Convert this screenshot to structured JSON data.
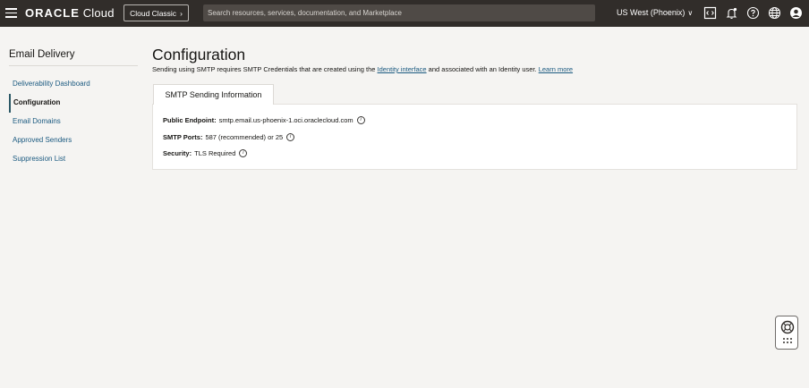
{
  "header": {
    "brand_oracle": "ORACLE",
    "brand_cloud": "Cloud",
    "classic_button": "Cloud Classic",
    "search_placeholder": "Search resources, services, documentation, and Marketplace",
    "region": "US West (Phoenix)",
    "icons": [
      "menu-icon",
      "code-editor-icon",
      "bell-icon",
      "help-icon",
      "globe-icon",
      "profile-icon"
    ]
  },
  "sidebar": {
    "title": "Email Delivery",
    "items": [
      {
        "label": "Deliverability Dashboard",
        "active": false
      },
      {
        "label": "Configuration",
        "active": true
      },
      {
        "label": "Email Domains",
        "active": false
      },
      {
        "label": "Approved Senders",
        "active": false
      },
      {
        "label": "Suppression List",
        "active": false
      }
    ]
  },
  "main": {
    "title": "Configuration",
    "desc_prefix": "Sending using SMTP requires SMTP Credentials that are created using the",
    "desc_link": "Identity interface",
    "desc_suffix": "and associated with an Identity user.",
    "learn_more": "Learn more",
    "tab": "SMTP Sending Information",
    "rows": [
      {
        "label": "Public Endpoint:",
        "value": "smtp.email.us-phoenix-1.oci.oraclecloud.com"
      },
      {
        "label": "SMTP Ports:",
        "value": "587 (recommended) or 25"
      },
      {
        "label": "Security:",
        "value": "TLS Required"
      }
    ]
  },
  "colors": {
    "topbar": "#312d2a",
    "link": "#1b5a80",
    "background": "#f5f4f2"
  }
}
